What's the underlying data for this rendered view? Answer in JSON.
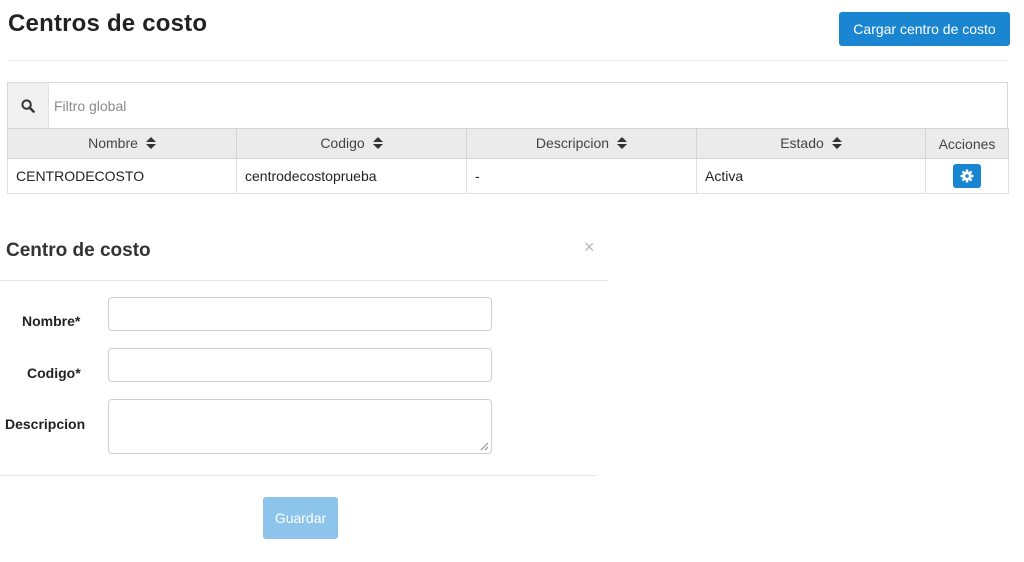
{
  "header": {
    "title": "Centros de costo",
    "load_button_label": "Cargar centro de costo"
  },
  "filter": {
    "placeholder": "Filtro global",
    "value": ""
  },
  "table": {
    "columns": [
      "Nombre",
      "Codigo",
      "Descripcion",
      "Estado",
      "Acciones"
    ],
    "rows": [
      {
        "nombre": "CENTRODECOSTO",
        "codigo": "centrodecostoprueba",
        "descripcion": "-",
        "estado": "Activa"
      }
    ]
  },
  "modal": {
    "title": "Centro de costo",
    "close_glyph": "×",
    "fields": {
      "nombre_label": "Nombre*",
      "nombre_value": "",
      "codigo_label": "Codigo*",
      "codigo_value": "",
      "descripcion_label": "Descripcion",
      "descripcion_value": ""
    },
    "save_label": "Guardar"
  },
  "colors": {
    "accent": "#1a86d1",
    "accent_disabled": "#8cc4ec",
    "header_bg": "#ebebeb"
  },
  "icons": {
    "filter": "search-icon",
    "sort": "sort-icon",
    "row_action": "gear-icon",
    "close": "close-icon"
  }
}
